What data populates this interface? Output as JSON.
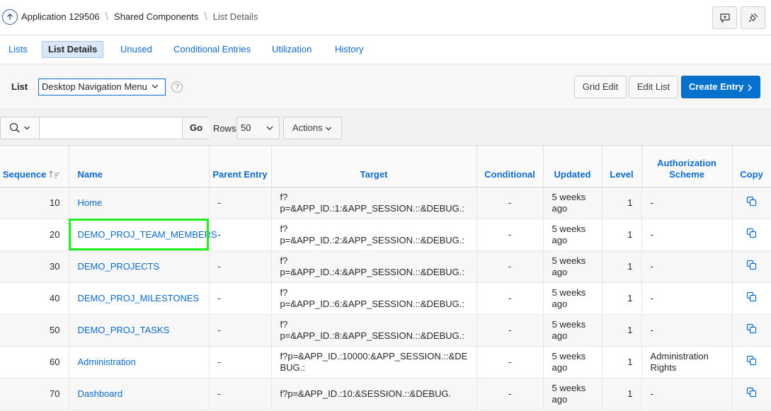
{
  "breadcrumb": {
    "items": [
      "Application 129506",
      "Shared Components",
      "List Details"
    ]
  },
  "tabs": [
    "Lists",
    "List Details",
    "Unused",
    "Conditional Entries",
    "Utilization",
    "History"
  ],
  "list_selector": {
    "label": "List",
    "value": "Desktop Navigation Menu",
    "help": "?"
  },
  "buttons": {
    "grid_edit": "Grid Edit",
    "edit_list": "Edit List",
    "create_entry": "Create Entry"
  },
  "toolbar": {
    "search_placeholder": "",
    "go": "Go",
    "rows_label": "Rows",
    "rows_value": "50",
    "actions": "Actions"
  },
  "table": {
    "columns": [
      "Sequence",
      "Name",
      "Parent Entry",
      "Target",
      "Conditional",
      "Updated",
      "Level",
      "Authorization Scheme",
      "Copy"
    ],
    "rows": [
      {
        "sequence": "10",
        "name": "Home",
        "parent": "-",
        "target": "f?p=&APP_ID.:1:&APP_SESSION.::&DEBUG.:",
        "conditional": "-",
        "updated": "5 weeks ago",
        "level": "1",
        "auth": "-"
      },
      {
        "sequence": "20",
        "name": "DEMO_PROJ_TEAM_MEMBERS",
        "parent": "-",
        "target": "f?p=&APP_ID.:2:&APP_SESSION.::&DEBUG.:",
        "conditional": "-",
        "updated": "5 weeks ago",
        "level": "1",
        "auth": "-"
      },
      {
        "sequence": "30",
        "name": "DEMO_PROJECTS",
        "parent": "-",
        "target": "f?p=&APP_ID.:4:&APP_SESSION.::&DEBUG.:",
        "conditional": "-",
        "updated": "5 weeks ago",
        "level": "1",
        "auth": "-"
      },
      {
        "sequence": "40",
        "name": "DEMO_PROJ_MILESTONES",
        "parent": "-",
        "target": "f?p=&APP_ID.:6:&APP_SESSION.::&DEBUG.:",
        "conditional": "-",
        "updated": "5 weeks ago",
        "level": "1",
        "auth": "-"
      },
      {
        "sequence": "50",
        "name": "DEMO_PROJ_TASKS",
        "parent": "-",
        "target": "f?p=&APP_ID.:8:&APP_SESSION.::&DEBUG.:",
        "conditional": "-",
        "updated": "5 weeks ago",
        "level": "1",
        "auth": "-"
      },
      {
        "sequence": "60",
        "name": "Administration",
        "parent": "-",
        "target": "f?p=&APP_ID.:10000:&APP_SESSION.::&DEBUG.:",
        "conditional": "-",
        "updated": "5 weeks ago",
        "level": "1",
        "auth": "Administration Rights"
      },
      {
        "sequence": "70",
        "name": "Dashboard",
        "parent": "-",
        "target": "f?p=&APP_ID.:10:&SESSION.::&DEBUG.",
        "conditional": "-",
        "updated": "5 weeks ago",
        "level": "1",
        "auth": "-"
      }
    ]
  },
  "colors": {
    "link": "#0d6ac9",
    "primary_button": "#0572ce",
    "active_tab_bg": "#d9e7f8",
    "highlight": "#1ef01e"
  }
}
